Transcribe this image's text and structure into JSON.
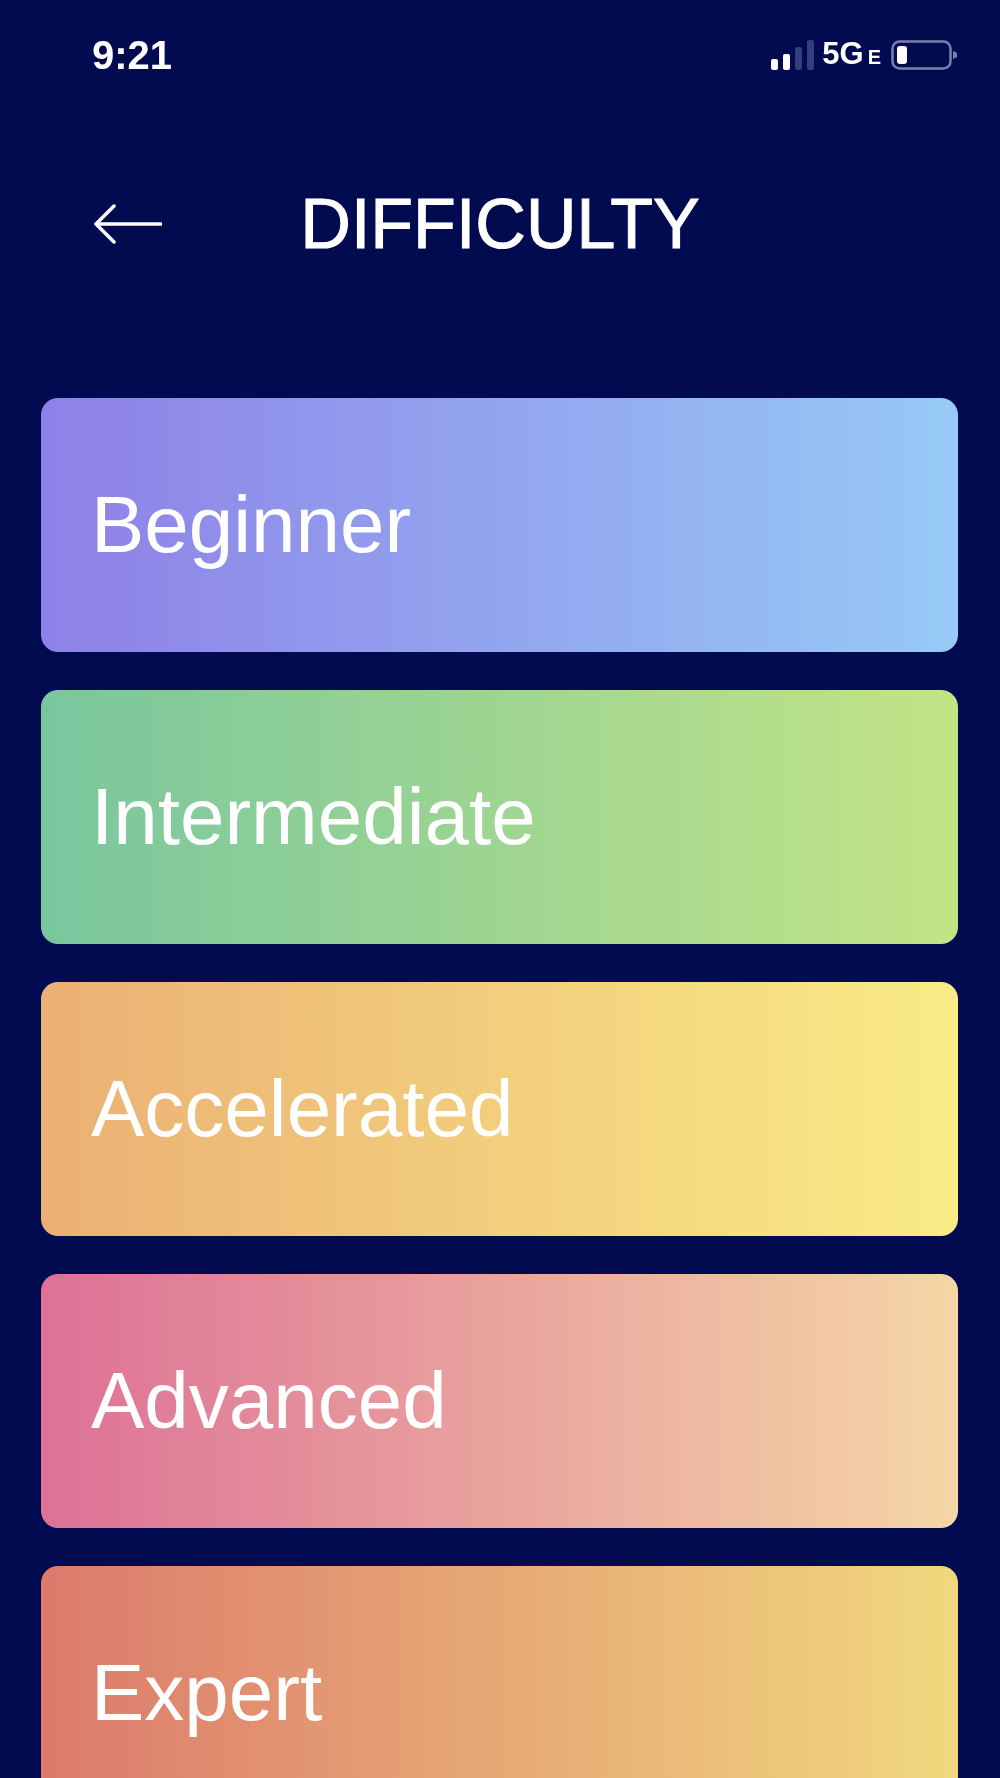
{
  "status_bar": {
    "time": "9:21",
    "network": "5G",
    "network_suffix": "E"
  },
  "header": {
    "title": "DIFFICULTY"
  },
  "levels": [
    {
      "label": "Beginner",
      "color": "#8e80e7",
      "gradient_end": {
        "color": "#97caf6"
      }
    },
    {
      "label": "Intermediate",
      "color": "#79c69e",
      "gradient_end": {
        "color": "#c3e486"
      }
    },
    {
      "label": "Accelerated",
      "color": "#ebb074",
      "gradient_end": {
        "color": "#f9ec86"
      }
    },
    {
      "label": "Advanced",
      "color": "#dd7196",
      "gradient_end": {
        "color": "#f5d6a6"
      }
    },
    {
      "label": "Expert",
      "color": "#dc7a6c",
      "gradient_end": {
        "color": "#f1d87e"
      }
    }
  ]
}
